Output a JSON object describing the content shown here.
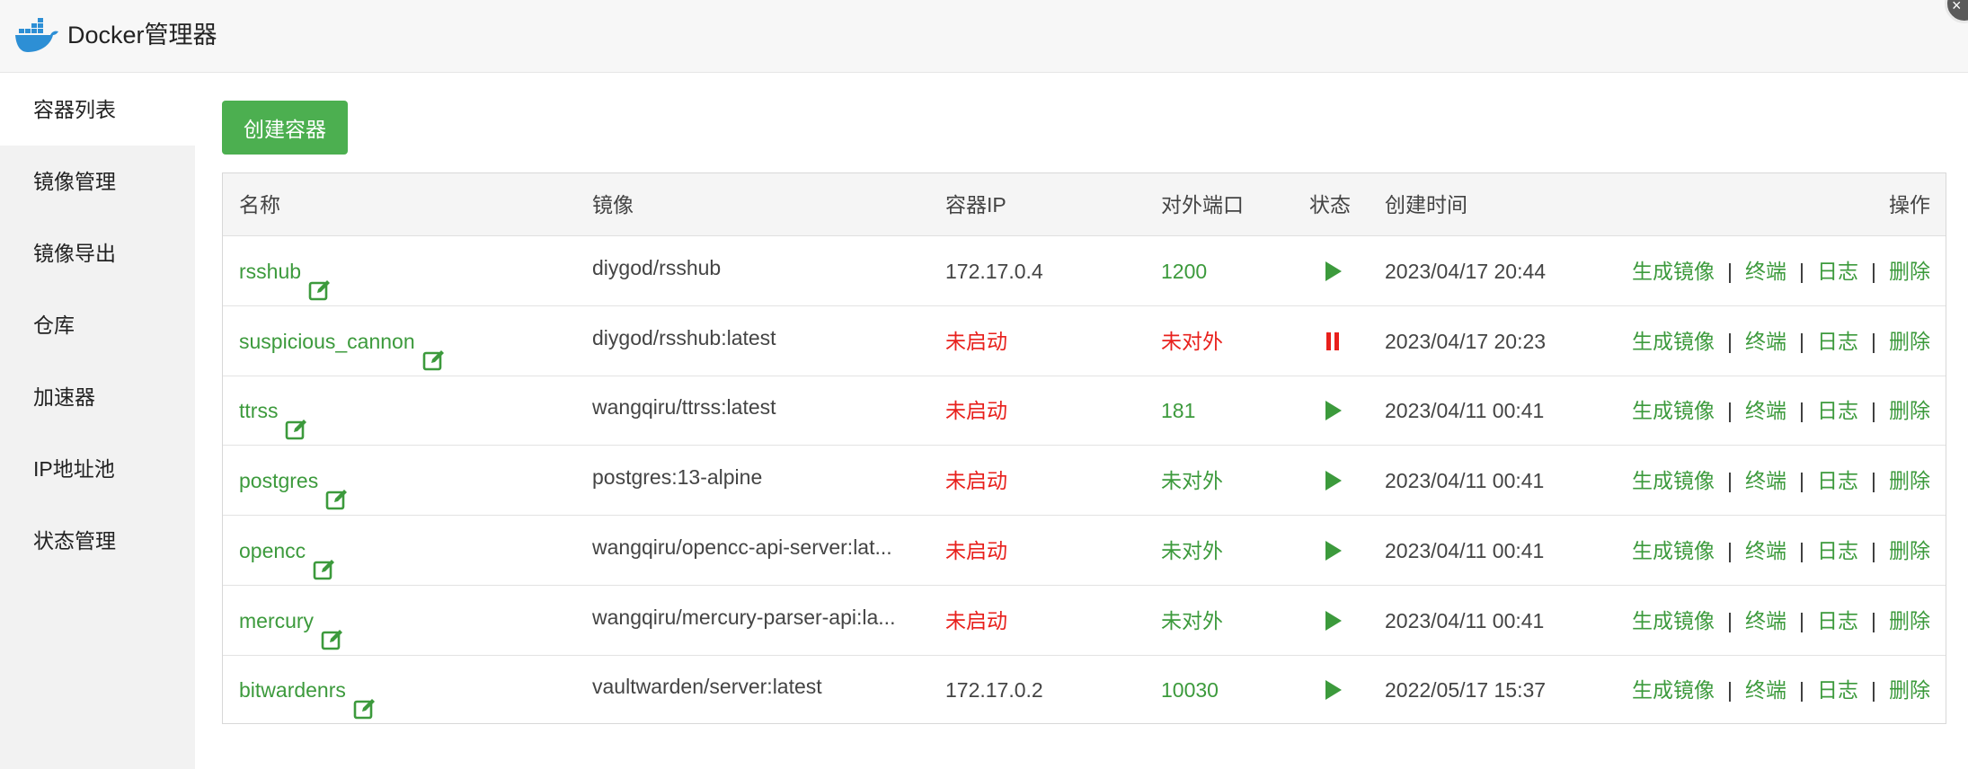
{
  "app": {
    "title": "Docker管理器"
  },
  "sidebar": {
    "items": [
      {
        "label": "容器列表",
        "active": true
      },
      {
        "label": "镜像管理",
        "active": false
      },
      {
        "label": "镜像导出",
        "active": false
      },
      {
        "label": "仓库",
        "active": false
      },
      {
        "label": "加速器",
        "active": false
      },
      {
        "label": "IP地址池",
        "active": false
      },
      {
        "label": "状态管理",
        "active": false
      }
    ]
  },
  "toolbar": {
    "create_label": "创建容器"
  },
  "table": {
    "headers": {
      "name": "名称",
      "image": "镜像",
      "ip": "容器IP",
      "port": "对外端口",
      "status": "状态",
      "created": "创建时间",
      "actions": "操作"
    },
    "action_labels": {
      "build": "生成镜像",
      "terminal": "终端",
      "log": "日志",
      "delete": "删除",
      "separator": "|"
    },
    "rows": [
      {
        "name": "rsshub",
        "image": "diygod/rsshub",
        "ip": "172.17.0.4",
        "ip_color": "#444444",
        "port": "1200",
        "port_color": "#3c9a3c",
        "status": "running",
        "created": "2023/04/17 20:44"
      },
      {
        "name": "suspicious_cannon",
        "image": "diygod/rsshub:latest",
        "ip": "未启动",
        "ip_color": "#e8201c",
        "port": "未对外",
        "port_color": "#e8201c",
        "status": "paused",
        "created": "2023/04/17 20:23"
      },
      {
        "name": "ttrss",
        "image": "wangqiru/ttrss:latest",
        "ip": "未启动",
        "ip_color": "#e8201c",
        "port": "181",
        "port_color": "#3c9a3c",
        "status": "running",
        "created": "2023/04/11 00:41"
      },
      {
        "name": "postgres",
        "image": "postgres:13-alpine",
        "ip": "未启动",
        "ip_color": "#e8201c",
        "port": "未对外",
        "port_color": "#3c9a3c",
        "status": "running",
        "created": "2023/04/11 00:41"
      },
      {
        "name": "opencc",
        "image": "wangqiru/opencc-api-server:lat...",
        "ip": "未启动",
        "ip_color": "#e8201c",
        "port": "未对外",
        "port_color": "#3c9a3c",
        "status": "running",
        "created": "2023/04/11 00:41"
      },
      {
        "name": "mercury",
        "image": "wangqiru/mercury-parser-api:la...",
        "ip": "未启动",
        "ip_color": "#e8201c",
        "port": "未对外",
        "port_color": "#3c9a3c",
        "status": "running",
        "created": "2023/04/11 00:41"
      },
      {
        "name": "bitwardenrs",
        "image": "vaultwarden/server:latest",
        "ip": "172.17.0.2",
        "ip_color": "#444444",
        "port": "10030",
        "port_color": "#3c9a3c",
        "status": "running",
        "created": "2022/05/17 15:37"
      }
    ]
  },
  "colors": {
    "accent_green": "#4caf50",
    "link_green": "#3c9a3c",
    "alert_red": "#e8201c",
    "docker_blue": "#2d8fd5"
  },
  "icons": {
    "logo": "docker-whale-icon",
    "edit": "edit-icon",
    "running": "play-icon",
    "paused": "pause-icon",
    "close": "close-icon"
  }
}
